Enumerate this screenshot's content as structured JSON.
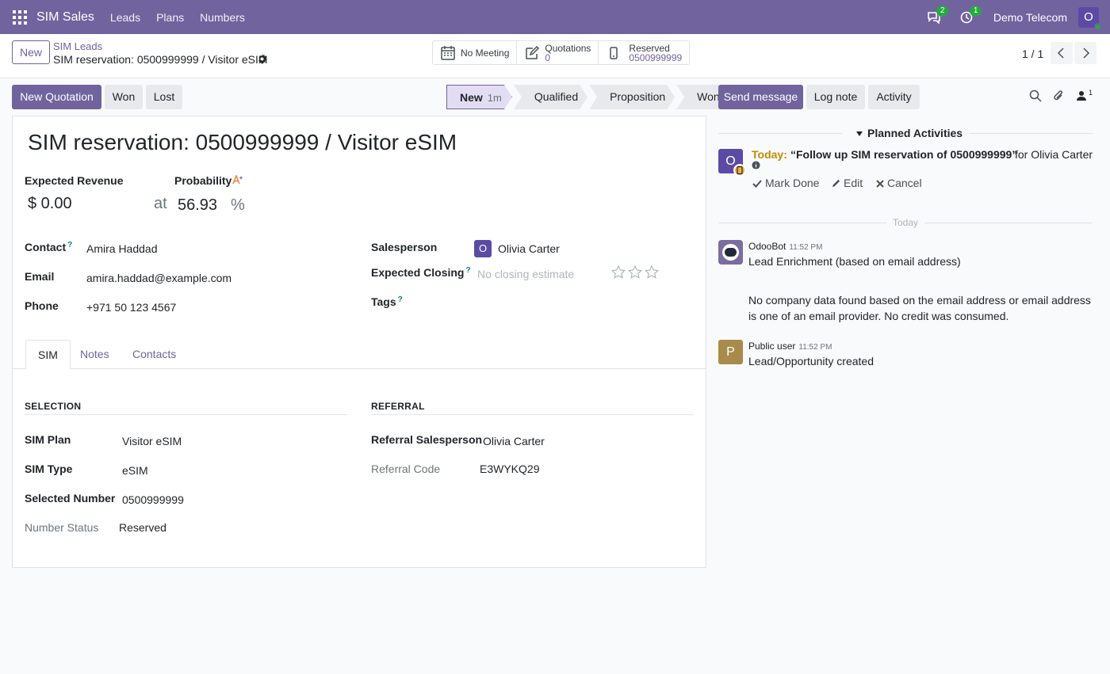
{
  "navbar": {
    "app_name": "SIM Sales",
    "menus": [
      "Leads",
      "Plans",
      "Numbers"
    ],
    "messages_count": "2",
    "activities_count": "1",
    "company": "Demo Telecom",
    "user_initial": "O"
  },
  "control": {
    "new_label": "New",
    "breadcrumb_parent": "SIM Leads",
    "breadcrumb_current": "SIM reservation: 0500999999 / Visitor eSIM",
    "stats": {
      "meeting": "No Meeting",
      "quotations_label": "Quotations",
      "quotations_value": "0",
      "reserved_label": "Reserved",
      "reserved_value": "0500999999"
    },
    "pager": "1 / 1"
  },
  "actions": {
    "new_quotation": "New Quotation",
    "won": "Won",
    "lost": "Lost"
  },
  "stages": [
    {
      "label": "New",
      "duration": "1m",
      "active": true
    },
    {
      "label": "Qualified"
    },
    {
      "label": "Proposition"
    },
    {
      "label": "Won"
    }
  ],
  "form": {
    "title": "SIM reservation: 0500999999 / Visitor eSIM",
    "expected_revenue_label": "Expected Revenue",
    "expected_revenue": "$ 0.00",
    "at": "at",
    "probability_label": "Probability",
    "probability": "56.93",
    "percent": "%",
    "contact_label": "Contact",
    "contact": "Amira Haddad",
    "email_label": "Email",
    "email": "amira.haddad@example.com",
    "phone_label": "Phone",
    "phone": "+971 50 123 4567",
    "salesperson_label": "Salesperson",
    "salesperson": "Olivia Carter",
    "salesperson_initial": "O",
    "expected_closing_label": "Expected Closing",
    "expected_closing_placeholder": "No closing estimate",
    "priority_stars": 0,
    "tags_label": "Tags",
    "help_mark": "?",
    "tabs": [
      "SIM",
      "Notes",
      "Contacts"
    ],
    "selection_head": "SELECTION",
    "sim_plan_label": "SIM Plan",
    "sim_plan": "Visitor eSIM",
    "sim_type_label": "SIM Type",
    "sim_type": "eSIM",
    "selected_number_label": "Selected Number",
    "selected_number": "0500999999",
    "number_status_label": "Number Status",
    "number_status": "Reserved",
    "referral_head": "REFERRAL",
    "referral_salesperson_label": "Referral Salesperson",
    "referral_salesperson": "Olivia Carter",
    "referral_code_label": "Referral Code",
    "referral_code": "E3WYKQ29"
  },
  "chatter": {
    "send_message": "Send message",
    "log_note": "Log note",
    "activity": "Activity",
    "followers_count": "1",
    "planned_activities": "Planned Activities",
    "activity_avatar": "O",
    "today_label": "Today:",
    "activity_summary": "“Follow up SIM reservation of 0500999999”",
    "activity_for": "for Olivia Carter",
    "mark_done": "Mark Done",
    "edit": "Edit",
    "cancel": "Cancel",
    "today_separator": "Today",
    "messages": [
      {
        "author": "OdooBot",
        "time": "11:52 PM",
        "body1": "Lead Enrichment (based on email address)",
        "body2": "No company data found based on the email address or email address is one of an email provider. No credit was consumed."
      },
      {
        "author": "Public user",
        "time": "11:52 PM",
        "avatar": "P",
        "body1": "Lead/Opportunity created"
      }
    ]
  },
  "colors": {
    "brand": "#71639e",
    "activity_today": "#c58b00",
    "badge_green": "#28a745"
  }
}
